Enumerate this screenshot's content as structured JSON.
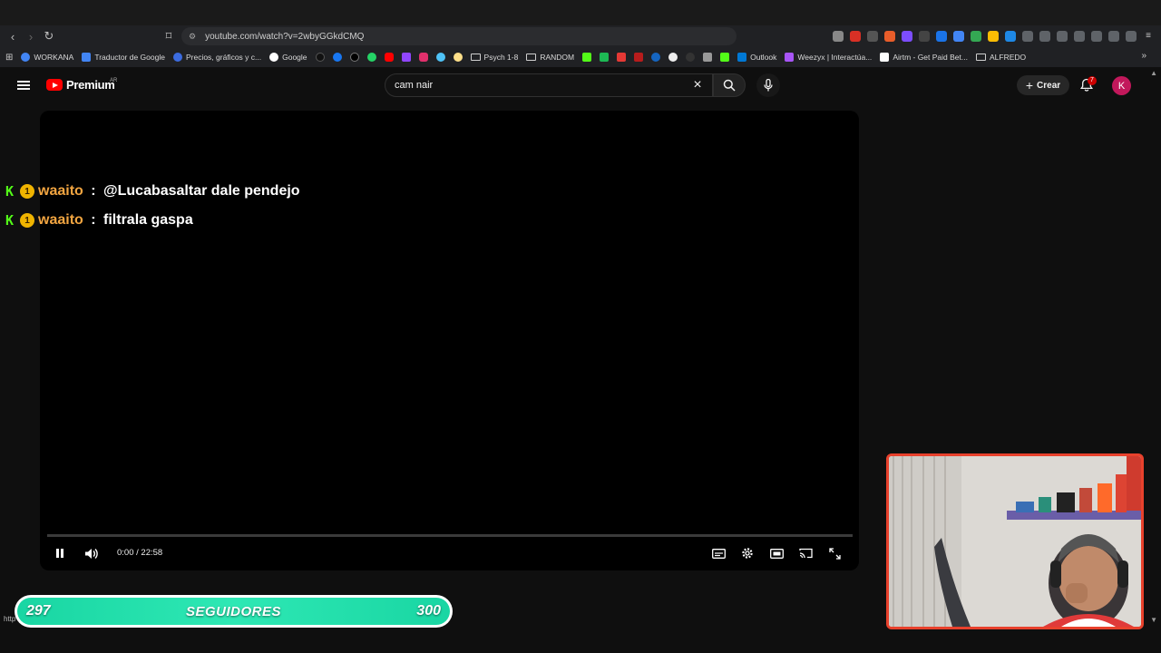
{
  "browser": {
    "url": "youtube.com/watch?v=2wbyGGkdCMQ",
    "bookmarks": [
      {
        "label": "WORKANA",
        "color": "#4285f4"
      },
      {
        "label": "Traductor de Google",
        "color": "#4285f4"
      },
      {
        "label": "Precios, gráficos y c...",
        "color": "#3c6ce0"
      },
      {
        "label": "Google",
        "color": "#ea4335"
      },
      {
        "label": "Psych 1-8",
        "color": "folder"
      },
      {
        "label": "RANDOM",
        "color": "folder"
      },
      {
        "label": "Outlook",
        "color": "#0078d4"
      },
      {
        "label": "Weezyx | Interactúa...",
        "color": "#a855f7"
      },
      {
        "label": "Airtm - Get Paid Bet...",
        "color": "#ffffff"
      },
      {
        "label": "ALFREDO",
        "color": "folder"
      }
    ],
    "status_url": "http"
  },
  "youtube": {
    "logo_text": "Premium",
    "country_code": "AR",
    "search_value": "cam nair",
    "create_label": "Crear",
    "notification_count": "7",
    "avatar_letter": "K"
  },
  "player": {
    "time": "0:00 / 22:58",
    "progress_fraction": 0
  },
  "chat": [
    {
      "user": "waaito",
      "separator": " : ",
      "message": "@Lucabasaltar dale pendejo"
    },
    {
      "user": "waaito",
      "separator": " : ",
      "message": "filtrala gaspa"
    }
  ],
  "followers_goal": {
    "current": "297",
    "label": "SEGUIDORES",
    "goal": "300"
  },
  "colors": {
    "accent_red": "#ff0000",
    "kick_green": "#53fc18",
    "goal_bar": "#19d6a3",
    "webcam_border": "#e8412c"
  }
}
